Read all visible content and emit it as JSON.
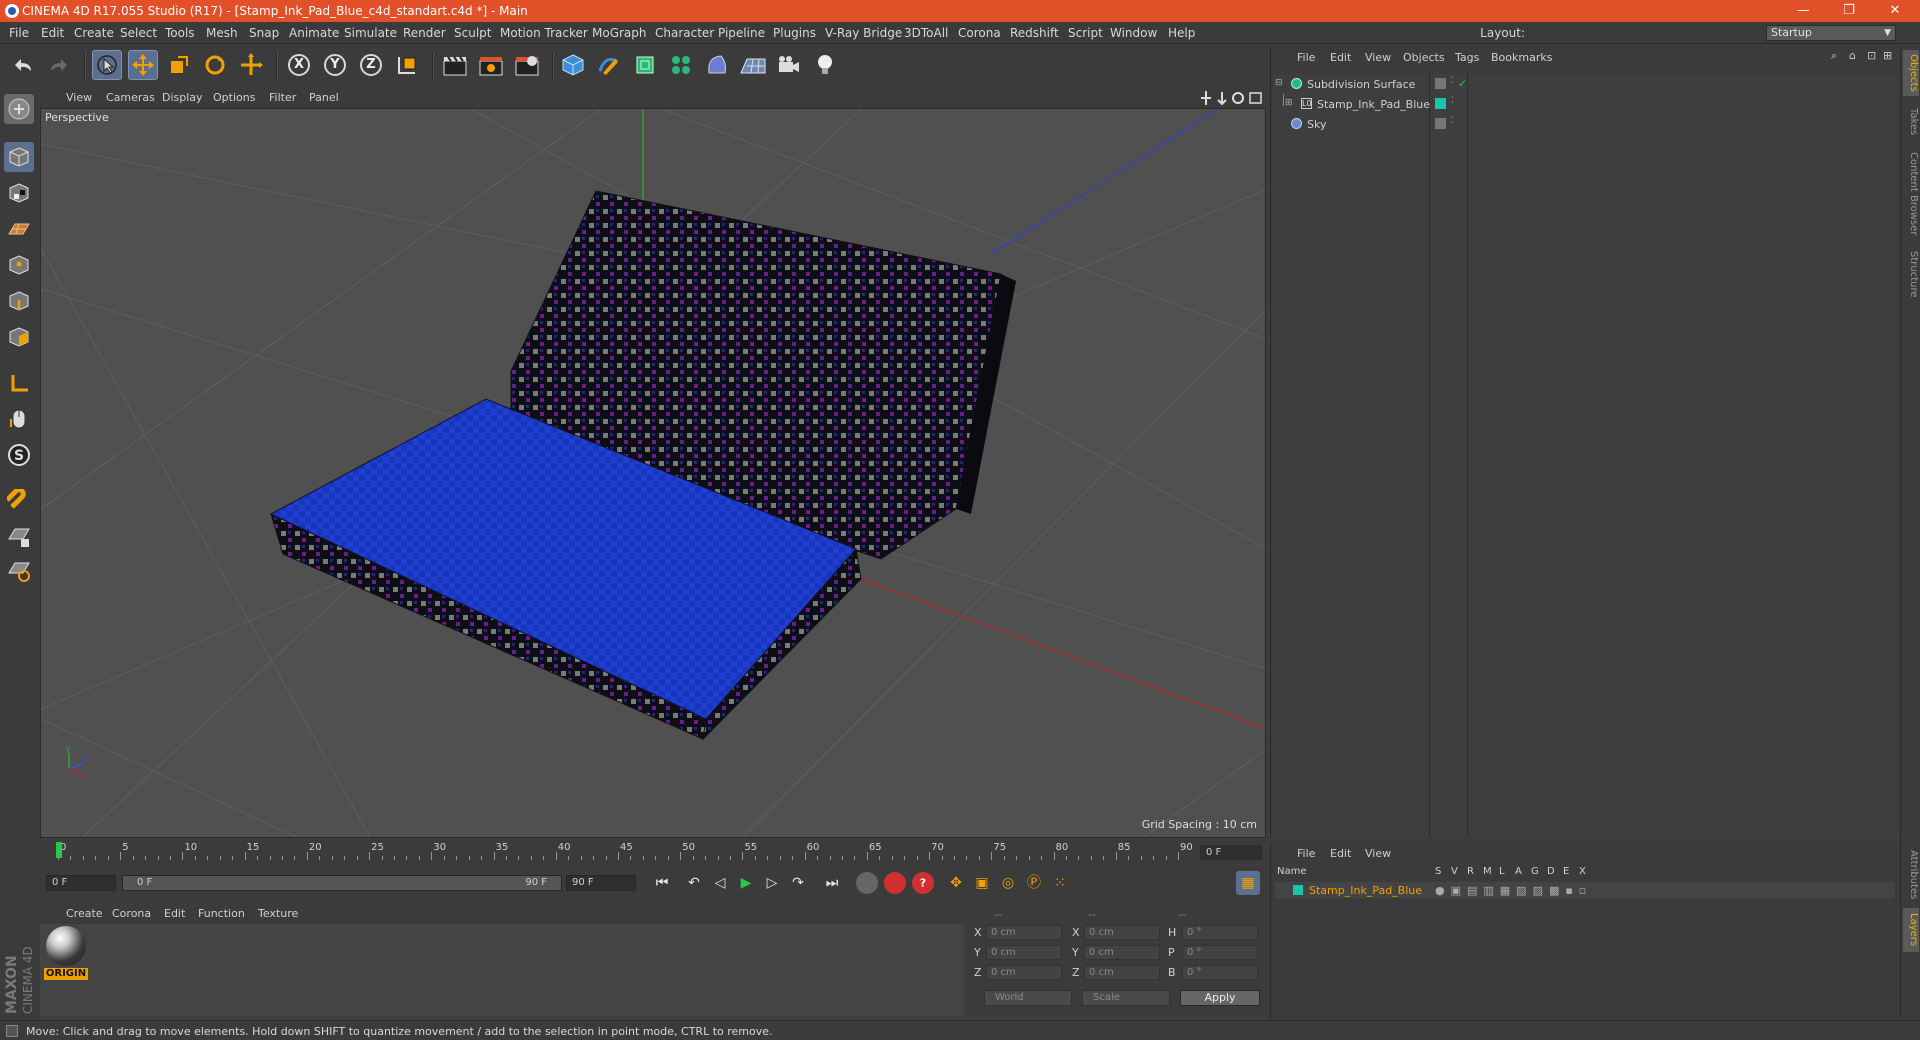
{
  "window": {
    "title": "CINEMA 4D R17.055 Studio (R17) - [Stamp_Ink_Pad_Blue_c4d_standart.c4d *] - Main",
    "controls": [
      "—",
      "❐",
      "✕"
    ]
  },
  "menu": [
    "File",
    "Edit",
    "Create",
    "Select",
    "Tools",
    "Mesh",
    "Snap",
    "Animate",
    "Simulate",
    "Render",
    "Sculpt",
    "Motion Tracker",
    "MoGraph",
    "Character",
    "Pipeline",
    "Plugins",
    "V-Ray Bridge",
    "3DToAll",
    "Corona",
    "Redshift",
    "Script",
    "Window",
    "Help"
  ],
  "layout": {
    "label": "Layout:",
    "value": "Startup"
  },
  "viewport": {
    "menu": [
      "View",
      "Cameras",
      "Display",
      "Options",
      "Filter",
      "Panel"
    ],
    "camera_label": "Perspective",
    "grid_spacing": "Grid Spacing : 10 cm"
  },
  "timeline": {
    "ticks": [
      "0",
      "5",
      "10",
      "15",
      "20",
      "25",
      "30",
      "35",
      "40",
      "45",
      "50",
      "55",
      "60",
      "65",
      "70",
      "75",
      "80",
      "85",
      "90"
    ],
    "end_frame_display": "0 F",
    "current_frame": "0 F",
    "range_start": "0 F",
    "range_end": "90 F",
    "max_frame": "90 F"
  },
  "materials": {
    "menu": [
      "Create",
      "Corona",
      "Edit",
      "Function",
      "Texture"
    ],
    "items": [
      {
        "label": "ORIGIN"
      }
    ]
  },
  "coordinates": {
    "headers": [
      "--",
      "--",
      "--"
    ],
    "rows": [
      {
        "a_label": "X",
        "a_val": "0 cm",
        "b_label": "X",
        "b_val": "0 cm",
        "c_label": "H",
        "c_val": "0 °"
      },
      {
        "a_label": "Y",
        "a_val": "0 cm",
        "b_label": "Y",
        "b_val": "0 cm",
        "c_label": "P",
        "c_val": "0 °"
      },
      {
        "a_label": "Z",
        "a_val": "0 cm",
        "b_label": "Z",
        "b_val": "0 cm",
        "c_label": "B",
        "c_val": "0 °"
      }
    ],
    "space_select": "World",
    "scale_select": "Scale",
    "apply": "Apply"
  },
  "object_manager": {
    "menu": [
      "File",
      "Edit",
      "View",
      "Objects",
      "Tags",
      "Bookmarks"
    ],
    "objects": [
      {
        "name": "Subdivision Surface",
        "indent": 0
      },
      {
        "name": "Stamp_Ink_Pad_Blue",
        "indent": 1
      },
      {
        "name": "Sky",
        "indent": 0
      }
    ]
  },
  "layer_manager": {
    "menu": [
      "File",
      "Edit",
      "View"
    ],
    "columns": [
      "Name",
      "S",
      "V",
      "R",
      "M",
      "L",
      "A",
      "G",
      "D",
      "E",
      "X"
    ],
    "layers": [
      {
        "name": "Stamp_Ink_Pad_Blue",
        "color": "#1ac6a8"
      }
    ]
  },
  "right_tabs": [
    "Objects",
    "Takes",
    "Content Browser",
    "Structure",
    "Attributes",
    "Layers"
  ],
  "status": "Move: Click and drag to move elements. Hold down SHIFT to quantize movement / add to the selection in point mode, CTRL to remove.",
  "brand": {
    "line1": "MAXON",
    "line2": "CINEMA 4D"
  },
  "colors": {
    "title_bar": "#e2502a",
    "accent": "#f0a000",
    "selection": "#5c6f8e",
    "pad_blue": "#1f3ed6"
  }
}
